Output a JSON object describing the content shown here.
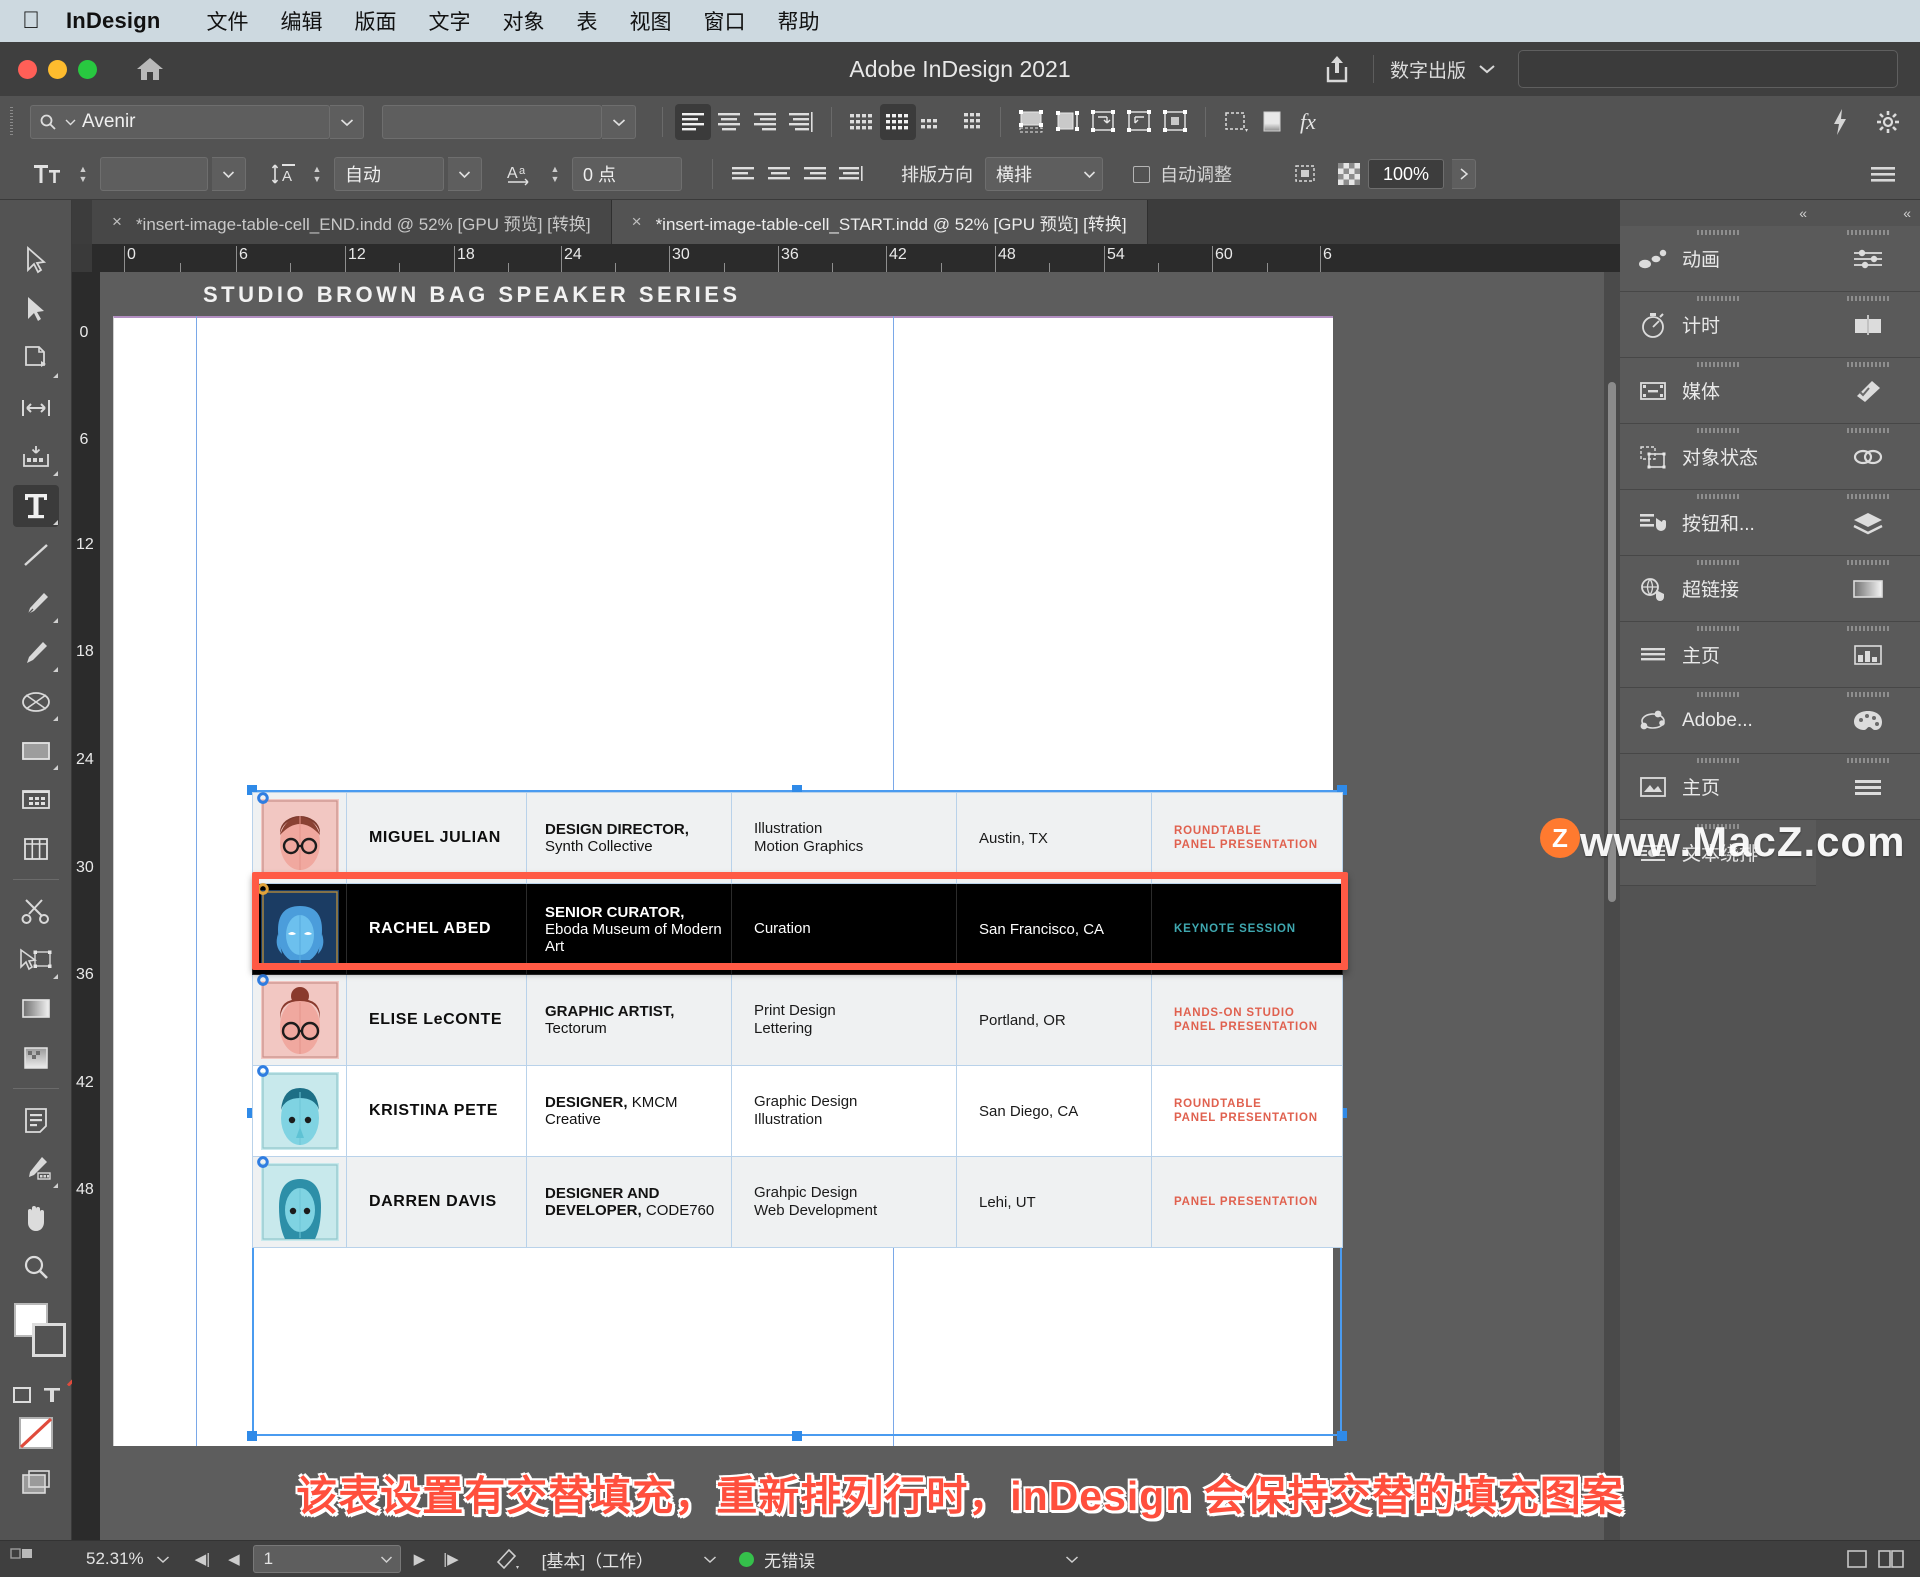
{
  "menubar": {
    "apple_icon": "apple-icon",
    "brand": "InDesign",
    "items": [
      "文件",
      "编辑",
      "版面",
      "文字",
      "对象",
      "表",
      "视图",
      "窗口",
      "帮助"
    ]
  },
  "titlebar": {
    "title": "Adobe InDesign 2021",
    "share_icon": "share-icon",
    "home_icon": "home-icon",
    "workspace": "数字出版",
    "search_placeholder": ""
  },
  "control_bar": {
    "font_family": "Avenir",
    "font_style": "",
    "font_size": "",
    "leading": "自动",
    "tracking": "0 点",
    "writing_direction_label": "排版方向",
    "writing_direction_value": "横排",
    "auto_fit_label": "自动调整",
    "opacity": "100%",
    "fx_label": "fx"
  },
  "tabs": [
    {
      "close": "×",
      "label": "*insert-image-table-cell_END.indd @ 52% [GPU 预览] [转换]",
      "active": false
    },
    {
      "close": "×",
      "label": "*insert-image-table-cell_START.indd @ 52% [GPU 预览] [转换]",
      "active": true
    }
  ],
  "toolbox": [
    {
      "name": "selection-tool",
      "selected": false
    },
    {
      "name": "direct-selection-tool",
      "selected": false
    },
    {
      "name": "page-tool",
      "selected": false
    },
    {
      "name": "gap-tool",
      "selected": false
    },
    {
      "name": "content-collector-tool",
      "selected": false
    },
    {
      "name": "type-tool",
      "selected": true
    },
    {
      "name": "line-tool",
      "selected": false
    },
    {
      "name": "pen-tool",
      "selected": false
    },
    {
      "name": "pencil-tool",
      "selected": false
    },
    {
      "name": "ellipse-frame-tool",
      "selected": false
    },
    {
      "name": "rectangle-tool",
      "selected": false
    },
    {
      "name": "free-transform-tool",
      "selected": false
    },
    {
      "name": "column-tool",
      "selected": false
    },
    {
      "name": "scissors-tool",
      "selected": false
    },
    {
      "name": "transform-tool",
      "selected": false
    },
    {
      "name": "gradient-swatch-tool",
      "selected": false
    },
    {
      "name": "gradient-feather-tool",
      "selected": false
    },
    {
      "name": "note-tool",
      "selected": false
    },
    {
      "name": "eyedropper-tool",
      "selected": false
    },
    {
      "name": "hand-tool",
      "selected": false
    },
    {
      "name": "zoom-tool",
      "selected": false
    }
  ],
  "document": {
    "page_heading": "STUDIO BROWN BAG SPEAKER SERIES",
    "ruler_h_ticks": [
      "0",
      "6",
      "12",
      "18",
      "24",
      "30",
      "36",
      "42",
      "48",
      "54",
      "60",
      "6"
    ],
    "ruler_v_ticks": [
      "0",
      "6",
      "12",
      "18",
      "24",
      "30",
      "36",
      "42",
      "48"
    ]
  },
  "table": {
    "rows": [
      {
        "avatar": "avatar-miguel",
        "name": "MIGUEL JULIAN",
        "title_bold": "DESIGN DIRECTOR,",
        "title_rest": "Synth Collective",
        "specialties": [
          "Illustration",
          "Motion Graphics"
        ],
        "location": "Austin, TX",
        "session": [
          "ROUNDTABLE",
          "PANEL PRESENTATION"
        ],
        "style": "shade"
      },
      {
        "avatar": "avatar-rachel",
        "name": "RACHEL ABED",
        "title_bold": "SENIOR CURATOR,",
        "title_rest": "Eboda Museum of Modern Art",
        "specialties": [
          "Curation"
        ],
        "location": "San Francisco, CA",
        "session": [
          "KEYNOTE SESSION"
        ],
        "style": "selected"
      },
      {
        "avatar": "avatar-elise",
        "name": "ELISE LeCONTE",
        "title_bold": "GRAPHIC ARTIST,",
        "title_rest": "Tectorum",
        "specialties": [
          "Print Design",
          "Lettering"
        ],
        "location": "Portland, OR",
        "session": [
          "HANDS-ON STUDIO",
          "PANEL PRESENTATION"
        ],
        "style": "shade"
      },
      {
        "avatar": "avatar-kristina",
        "name": "KRISTINA PETE",
        "title_bold": "DESIGNER,",
        "title_rest": "KMCM Creative",
        "specialties": [
          "Graphic Design",
          "Illustration"
        ],
        "location": "San Diego, CA",
        "session": [
          "ROUNDTABLE",
          "PANEL PRESENTATION"
        ],
        "style": "plain"
      },
      {
        "avatar": "avatar-darren",
        "name": "DARREN DAVIS",
        "title_bold": "DESIGNER AND DEVELOPER,",
        "title_rest": "CODE760",
        "specialties": [
          "Grahpic Design",
          "Web Development"
        ],
        "location": "Lehi, UT",
        "session": [
          "PANEL PRESENTATION"
        ],
        "style": "shade"
      }
    ]
  },
  "right_panels": {
    "collapse_icon": "collapse-chevrons-icon",
    "wide_items": [
      {
        "icon": "animation-icon",
        "label": "动画"
      },
      {
        "icon": "timing-icon",
        "label": "计时"
      },
      {
        "icon": "media-icon",
        "label": "媒体"
      },
      {
        "icon": "object-states-icon",
        "label": "对象状态"
      },
      {
        "icon": "buttons-forms-icon",
        "label": "按钮和..."
      },
      {
        "icon": "hyperlinks-icon",
        "label": "超链接"
      },
      {
        "icon": "pages-icon",
        "label": "主页"
      },
      {
        "icon": "adobe-share-icon",
        "label": "Adobe..."
      },
      {
        "icon": "master-pages-icon",
        "label": "主页"
      },
      {
        "icon": "text-wrap-icon",
        "label": "文本绕排"
      }
    ],
    "narrow_items": [
      {
        "icon": "properties-icon"
      },
      {
        "icon": "pages-spread-icon"
      },
      {
        "icon": "preflight-icon"
      },
      {
        "icon": "links-icon"
      },
      {
        "icon": "layers-icon"
      },
      {
        "icon": "gradient-icon"
      },
      {
        "icon": "libraries-icon"
      },
      {
        "icon": "color-palette-icon"
      },
      {
        "icon": "paragraph-styles-icon"
      }
    ]
  },
  "caption": "该表设置有交替填充，重新排列行时，inDesign 会保持交替的填充图案",
  "watermark": {
    "badge": "Z",
    "text": "www.MacZ.com"
  },
  "statusbar": {
    "zoom": "52.31%",
    "page": "1",
    "preflight_profile": "[基本]（工作）",
    "error_status": "无错误",
    "error_color": "#35c04b"
  }
}
